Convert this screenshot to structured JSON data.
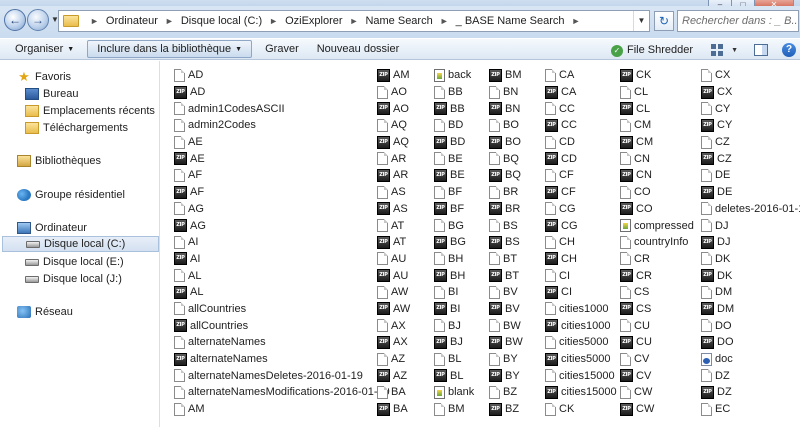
{
  "window": {
    "controls": [
      "–",
      "□",
      "✕"
    ]
  },
  "address": {
    "breadcrumbs": [
      "Ordinateur",
      "Disque local (C:)",
      "OziExplorer",
      "Name Search",
      "_ BASE Name Search"
    ],
    "search_placeholder": "Rechercher dans : _ B..."
  },
  "toolbar": {
    "organize": "Organiser",
    "include_library": "Inclure dans la bibliothèque",
    "burn": "Graver",
    "new_folder": "Nouveau dossier",
    "file_shredder": "File Shredder"
  },
  "sidebar": {
    "favorites": "Favoris",
    "desktop": "Bureau",
    "recent": "Emplacements récents",
    "downloads": "Téléchargements",
    "libraries": "Bibliothèques",
    "homegroup": "Groupe résidentiel",
    "computer": "Ordinateur",
    "disk_c": "Disque local (C:)",
    "disk_e": "Disque local (E:)",
    "disk_j": "Disque local (J:)",
    "network": "Réseau"
  },
  "files": {
    "columns": [
      [
        {
          "name": "AD",
          "icon": "doc"
        },
        {
          "name": "AD",
          "icon": "zip"
        },
        {
          "name": "admin1CodesASCII",
          "icon": "doc"
        },
        {
          "name": "admin2Codes",
          "icon": "doc"
        },
        {
          "name": "AE",
          "icon": "doc"
        },
        {
          "name": "AE",
          "icon": "zip"
        },
        {
          "name": "AF",
          "icon": "doc"
        },
        {
          "name": "AF",
          "icon": "zip"
        },
        {
          "name": "AG",
          "icon": "doc"
        },
        {
          "name": "AG",
          "icon": "zip"
        },
        {
          "name": "AI",
          "icon": "doc"
        },
        {
          "name": "AI",
          "icon": "zip"
        },
        {
          "name": "AL",
          "icon": "doc"
        },
        {
          "name": "AL",
          "icon": "zip"
        },
        {
          "name": "allCountries",
          "icon": "doc"
        },
        {
          "name": "allCountries",
          "icon": "zip"
        },
        {
          "name": "alternateNames",
          "icon": "doc"
        },
        {
          "name": "alternateNames",
          "icon": "zip"
        },
        {
          "name": "alternateNamesDeletes-2016-01-19",
          "icon": "doc"
        },
        {
          "name": "alternateNamesModifications-2016-01-19",
          "icon": "doc"
        },
        {
          "name": "AM",
          "icon": "doc"
        }
      ],
      [
        {
          "name": "AM",
          "icon": "zip"
        },
        {
          "name": "AO",
          "icon": "doc"
        },
        {
          "name": "AO",
          "icon": "zip"
        },
        {
          "name": "AQ",
          "icon": "doc"
        },
        {
          "name": "AQ",
          "icon": "zip"
        },
        {
          "name": "AR",
          "icon": "doc"
        },
        {
          "name": "AR",
          "icon": "zip"
        },
        {
          "name": "AS",
          "icon": "doc"
        },
        {
          "name": "AS",
          "icon": "zip"
        },
        {
          "name": "AT",
          "icon": "doc"
        },
        {
          "name": "AT",
          "icon": "zip"
        },
        {
          "name": "AU",
          "icon": "doc"
        },
        {
          "name": "AU",
          "icon": "zip"
        },
        {
          "name": "AW",
          "icon": "doc"
        },
        {
          "name": "AW",
          "icon": "zip"
        },
        {
          "name": "AX",
          "icon": "doc"
        },
        {
          "name": "AX",
          "icon": "zip"
        },
        {
          "name": "AZ",
          "icon": "doc"
        },
        {
          "name": "AZ",
          "icon": "zip"
        },
        {
          "name": "BA",
          "icon": "doc"
        },
        {
          "name": "BA",
          "icon": "zip"
        }
      ],
      [
        {
          "name": "back",
          "icon": "img"
        },
        {
          "name": "BB",
          "icon": "doc"
        },
        {
          "name": "BB",
          "icon": "zip"
        },
        {
          "name": "BD",
          "icon": "doc"
        },
        {
          "name": "BD",
          "icon": "zip"
        },
        {
          "name": "BE",
          "icon": "doc"
        },
        {
          "name": "BE",
          "icon": "zip"
        },
        {
          "name": "BF",
          "icon": "doc"
        },
        {
          "name": "BF",
          "icon": "zip"
        },
        {
          "name": "BG",
          "icon": "doc"
        },
        {
          "name": "BG",
          "icon": "zip"
        },
        {
          "name": "BH",
          "icon": "doc"
        },
        {
          "name": "BH",
          "icon": "zip"
        },
        {
          "name": "BI",
          "icon": "doc"
        },
        {
          "name": "BI",
          "icon": "zip"
        },
        {
          "name": "BJ",
          "icon": "doc"
        },
        {
          "name": "BJ",
          "icon": "zip"
        },
        {
          "name": "BL",
          "icon": "doc"
        },
        {
          "name": "BL",
          "icon": "zip"
        },
        {
          "name": "blank",
          "icon": "img"
        },
        {
          "name": "BM",
          "icon": "doc"
        }
      ],
      [
        {
          "name": "BM",
          "icon": "zip"
        },
        {
          "name": "BN",
          "icon": "doc"
        },
        {
          "name": "BN",
          "icon": "zip"
        },
        {
          "name": "BO",
          "icon": "doc"
        },
        {
          "name": "BO",
          "icon": "zip"
        },
        {
          "name": "BQ",
          "icon": "doc"
        },
        {
          "name": "BQ",
          "icon": "zip"
        },
        {
          "name": "BR",
          "icon": "doc"
        },
        {
          "name": "BR",
          "icon": "zip"
        },
        {
          "name": "BS",
          "icon": "doc"
        },
        {
          "name": "BS",
          "icon": "zip"
        },
        {
          "name": "BT",
          "icon": "doc"
        },
        {
          "name": "BT",
          "icon": "zip"
        },
        {
          "name": "BV",
          "icon": "doc"
        },
        {
          "name": "BV",
          "icon": "zip"
        },
        {
          "name": "BW",
          "icon": "doc"
        },
        {
          "name": "BW",
          "icon": "zip"
        },
        {
          "name": "BY",
          "icon": "doc"
        },
        {
          "name": "BY",
          "icon": "zip"
        },
        {
          "name": "BZ",
          "icon": "doc"
        },
        {
          "name": "BZ",
          "icon": "zip"
        }
      ],
      [
        {
          "name": "CA",
          "icon": "doc"
        },
        {
          "name": "CA",
          "icon": "zip"
        },
        {
          "name": "CC",
          "icon": "doc"
        },
        {
          "name": "CC",
          "icon": "zip"
        },
        {
          "name": "CD",
          "icon": "doc"
        },
        {
          "name": "CD",
          "icon": "zip"
        },
        {
          "name": "CF",
          "icon": "doc"
        },
        {
          "name": "CF",
          "icon": "zip"
        },
        {
          "name": "CG",
          "icon": "doc"
        },
        {
          "name": "CG",
          "icon": "zip"
        },
        {
          "name": "CH",
          "icon": "doc"
        },
        {
          "name": "CH",
          "icon": "zip"
        },
        {
          "name": "CI",
          "icon": "doc"
        },
        {
          "name": "CI",
          "icon": "zip"
        },
        {
          "name": "cities1000",
          "icon": "doc"
        },
        {
          "name": "cities1000",
          "icon": "zip"
        },
        {
          "name": "cities5000",
          "icon": "doc"
        },
        {
          "name": "cities5000",
          "icon": "zip"
        },
        {
          "name": "cities15000",
          "icon": "doc"
        },
        {
          "name": "cities15000",
          "icon": "zip"
        },
        {
          "name": "CK",
          "icon": "doc"
        }
      ],
      [
        {
          "name": "CK",
          "icon": "zip"
        },
        {
          "name": "CL",
          "icon": "doc"
        },
        {
          "name": "CL",
          "icon": "zip"
        },
        {
          "name": "CM",
          "icon": "doc"
        },
        {
          "name": "CM",
          "icon": "zip"
        },
        {
          "name": "CN",
          "icon": "doc"
        },
        {
          "name": "CN",
          "icon": "zip"
        },
        {
          "name": "CO",
          "icon": "doc"
        },
        {
          "name": "CO",
          "icon": "zip"
        },
        {
          "name": "compressed",
          "icon": "img"
        },
        {
          "name": "countryInfo",
          "icon": "doc"
        },
        {
          "name": "CR",
          "icon": "doc"
        },
        {
          "name": "CR",
          "icon": "zip"
        },
        {
          "name": "CS",
          "icon": "doc"
        },
        {
          "name": "CS",
          "icon": "zip"
        },
        {
          "name": "CU",
          "icon": "doc"
        },
        {
          "name": "CU",
          "icon": "zip"
        },
        {
          "name": "CV",
          "icon": "doc"
        },
        {
          "name": "CV",
          "icon": "zip"
        },
        {
          "name": "CW",
          "icon": "doc"
        },
        {
          "name": "CW",
          "icon": "zip"
        }
      ],
      [
        {
          "name": "CX",
          "icon": "doc"
        },
        {
          "name": "CX",
          "icon": "zip"
        },
        {
          "name": "CY",
          "icon": "doc"
        },
        {
          "name": "CY",
          "icon": "zip"
        },
        {
          "name": "CZ",
          "icon": "doc"
        },
        {
          "name": "CZ",
          "icon": "zip"
        },
        {
          "name": "DE",
          "icon": "doc"
        },
        {
          "name": "DE",
          "icon": "zip"
        },
        {
          "name": "deletes-2016-01-19",
          "icon": "doc"
        },
        {
          "name": "DJ",
          "icon": "doc"
        },
        {
          "name": "DJ",
          "icon": "zip"
        },
        {
          "name": "DK",
          "icon": "doc"
        },
        {
          "name": "DK",
          "icon": "zip"
        },
        {
          "name": "DM",
          "icon": "doc"
        },
        {
          "name": "DM",
          "icon": "zip"
        },
        {
          "name": "DO",
          "icon": "doc"
        },
        {
          "name": "DO",
          "icon": "zip"
        },
        {
          "name": "doc",
          "icon": "word"
        },
        {
          "name": "DZ",
          "icon": "doc"
        },
        {
          "name": "DZ",
          "icon": "zip"
        },
        {
          "name": "EC",
          "icon": "doc"
        }
      ]
    ]
  }
}
